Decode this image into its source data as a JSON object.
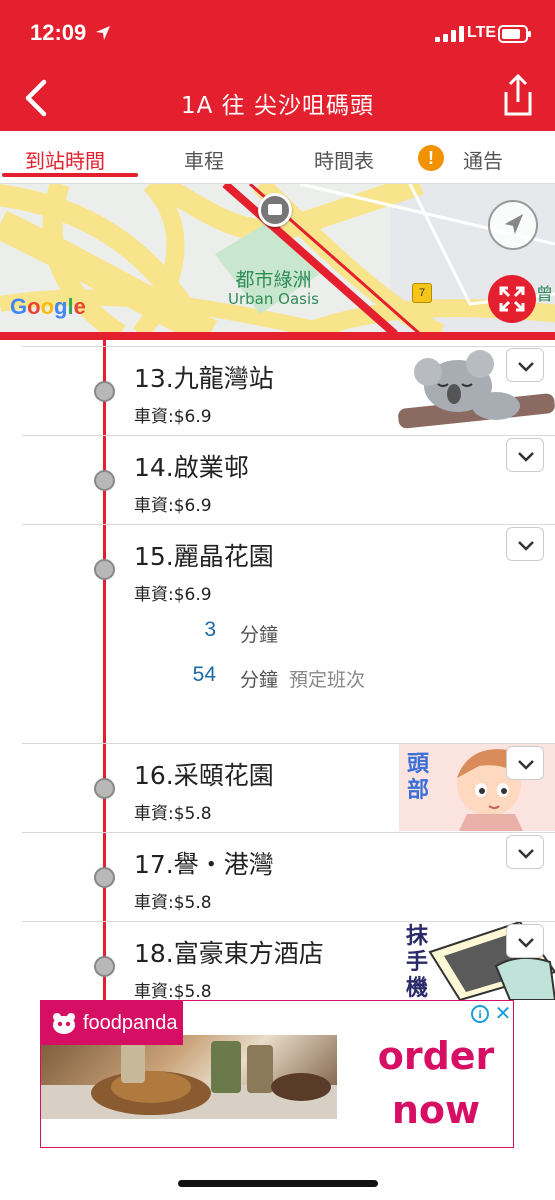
{
  "status": {
    "time": "12:09",
    "network": "LTE"
  },
  "nav": {
    "title": "1A 往 尖沙咀碼頭"
  },
  "tabs": [
    {
      "label": "到站時間",
      "active": true
    },
    {
      "label": "車程",
      "active": false
    },
    {
      "label": "時間表",
      "active": false
    },
    {
      "label": "通告",
      "active": false
    }
  ],
  "notice_icon_glyph": "!",
  "map": {
    "google": {
      "G": "G",
      "o1": "o",
      "o2": "o",
      "g": "g",
      "l": "l",
      "e": "e"
    },
    "place_cn": "都市綠洲",
    "place_en": "Urban Oasis",
    "route_badge": "7",
    "edge_label": "曾"
  },
  "stops": [
    {
      "name": "13.九龍灣站",
      "fare": "車資:$6.9"
    },
    {
      "name": "14.啟業邨",
      "fare": "車資:$6.9"
    },
    {
      "name": "15.麗晶花園",
      "fare": "車資:$6.9",
      "etas": [
        {
          "minutes": "3",
          "unit": "分鐘",
          "note": ""
        },
        {
          "minutes": "54",
          "unit": "分鐘",
          "note": "預定班次"
        }
      ]
    },
    {
      "name": "16.采頤花園",
      "fare": "車資:$5.8"
    },
    {
      "name": "17.譽・港灣",
      "fare": "車資:$5.8"
    },
    {
      "name": "18.富豪東方酒店",
      "fare": "車資:$5.8"
    }
  ],
  "stickers": {
    "head_text": "頭部",
    "phone_text": "抹手機"
  },
  "ad": {
    "brand": "foodpanda",
    "cta_line1": "order",
    "cta_line2": "now",
    "info": "i",
    "close": "✕"
  },
  "colors": {
    "brand_red": "#e4202e",
    "eta_blue": "#1a6aa8",
    "ad_pink": "#d70f64"
  }
}
